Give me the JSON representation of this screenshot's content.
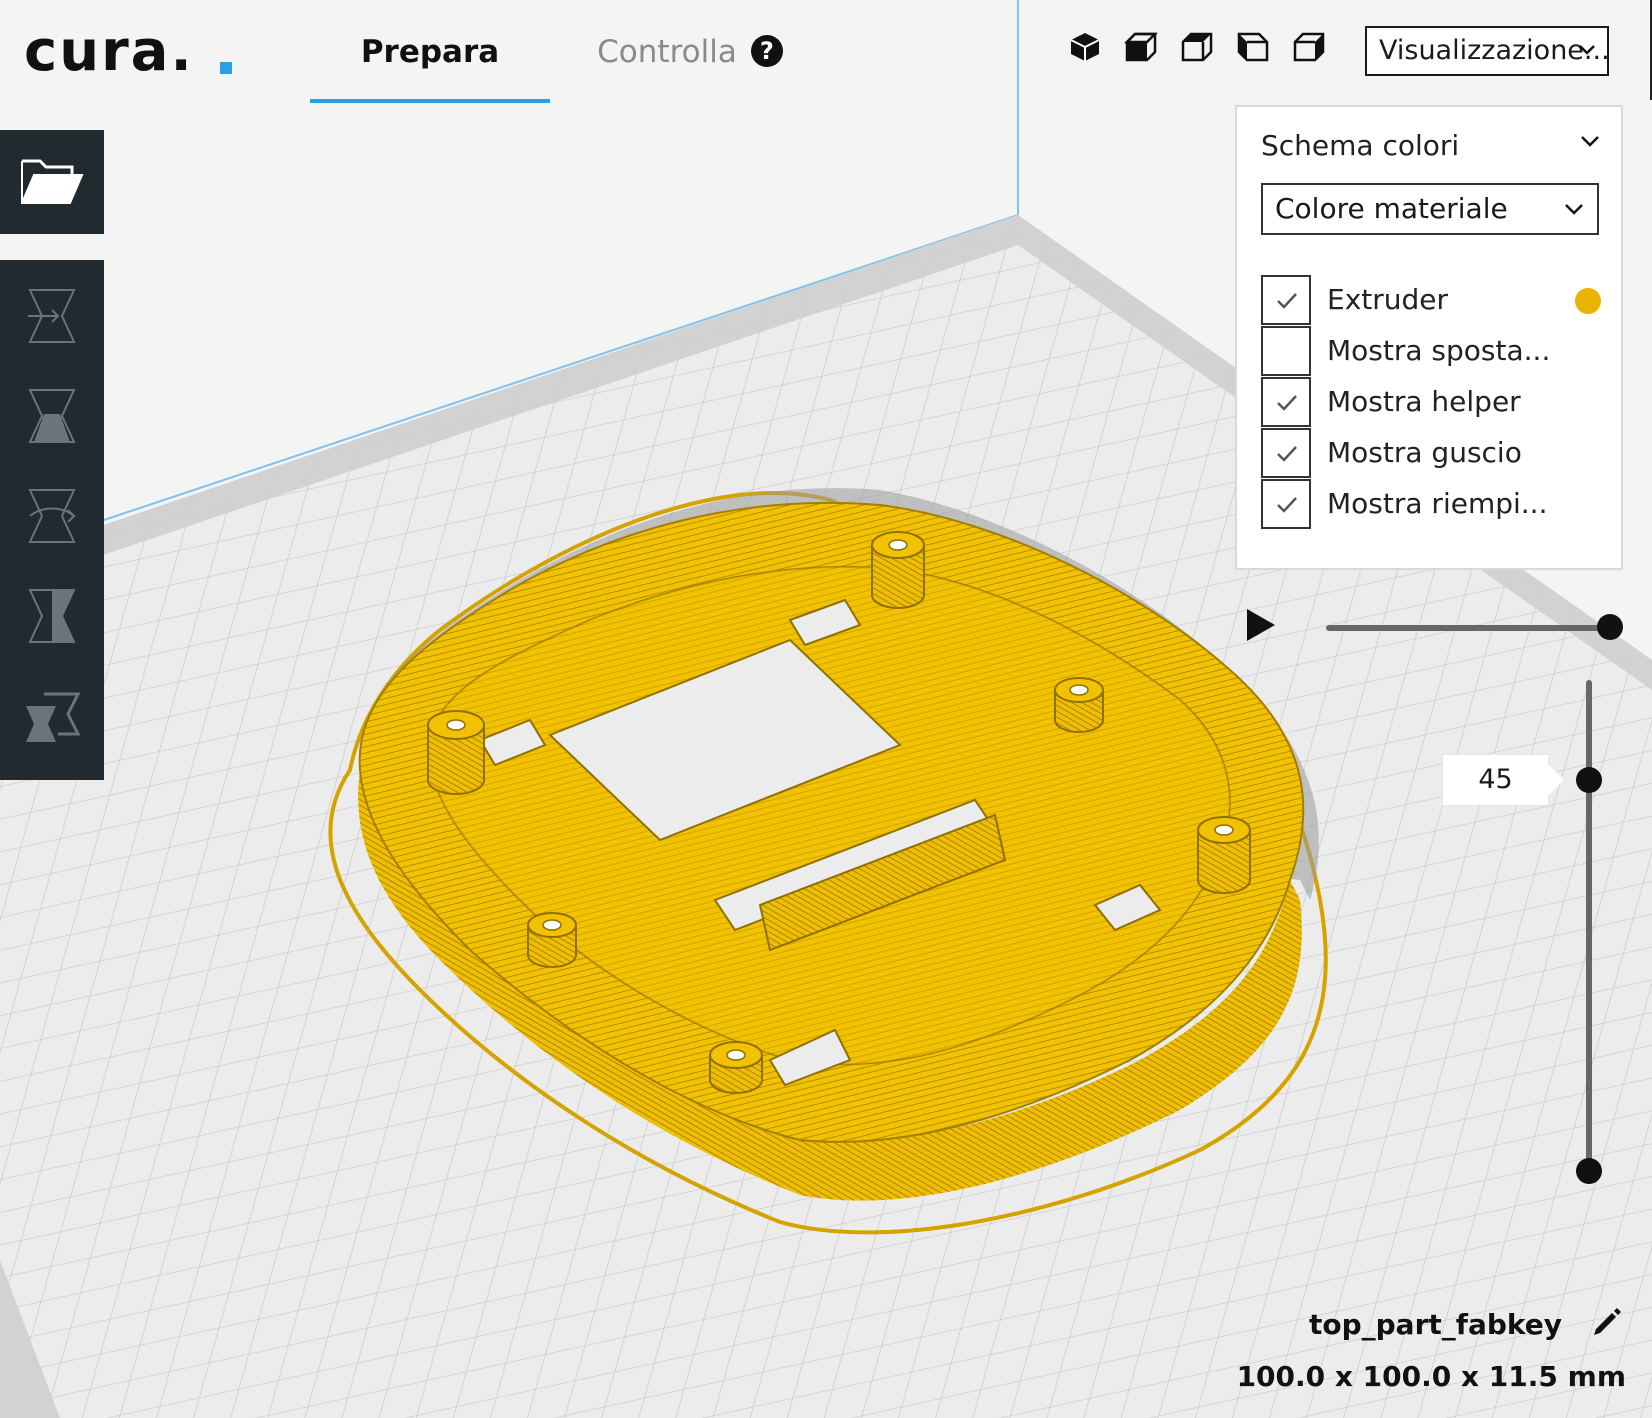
{
  "header": {
    "logo_text": "cura.",
    "tabs": [
      {
        "label": "Prepara",
        "active": true
      },
      {
        "label": "Controlla",
        "active": false
      }
    ],
    "help_glyph": "?",
    "view_select_value": "Visualizzazione..."
  },
  "view_panel": {
    "title": "Schema colori",
    "color_scheme_value": "Colore materiale",
    "options": [
      {
        "label": "Extruder",
        "checked": true,
        "swatch": "#e8b400"
      },
      {
        "label": "Mostra sposta...",
        "checked": false
      },
      {
        "label": "Mostra helper",
        "checked": true
      },
      {
        "label": "Mostra guscio",
        "checked": true
      },
      {
        "label": "Mostra riempi...",
        "checked": true
      }
    ]
  },
  "layer_view": {
    "current_layer": "45"
  },
  "object": {
    "name": "top_part_fabkey",
    "dimensions": "100.0 x 100.0 x 11.5 mm"
  },
  "colors": {
    "accent": "#2aa0e0",
    "material": "#f2c200",
    "toolbar": "#212a2f",
    "build_plate": "#e8e8e8",
    "grid": "#bfbfbf"
  },
  "icons": [
    "folder-open-icon",
    "move-tool-icon",
    "scale-tool-icon",
    "rotate-tool-icon",
    "mirror-tool-icon",
    "per-model-settings-icon",
    "view-3d-icon",
    "view-front-icon",
    "view-top-icon",
    "view-left-icon",
    "view-right-icon",
    "chevron-down-icon",
    "check-icon",
    "play-icon",
    "pencil-icon",
    "help-icon"
  ]
}
